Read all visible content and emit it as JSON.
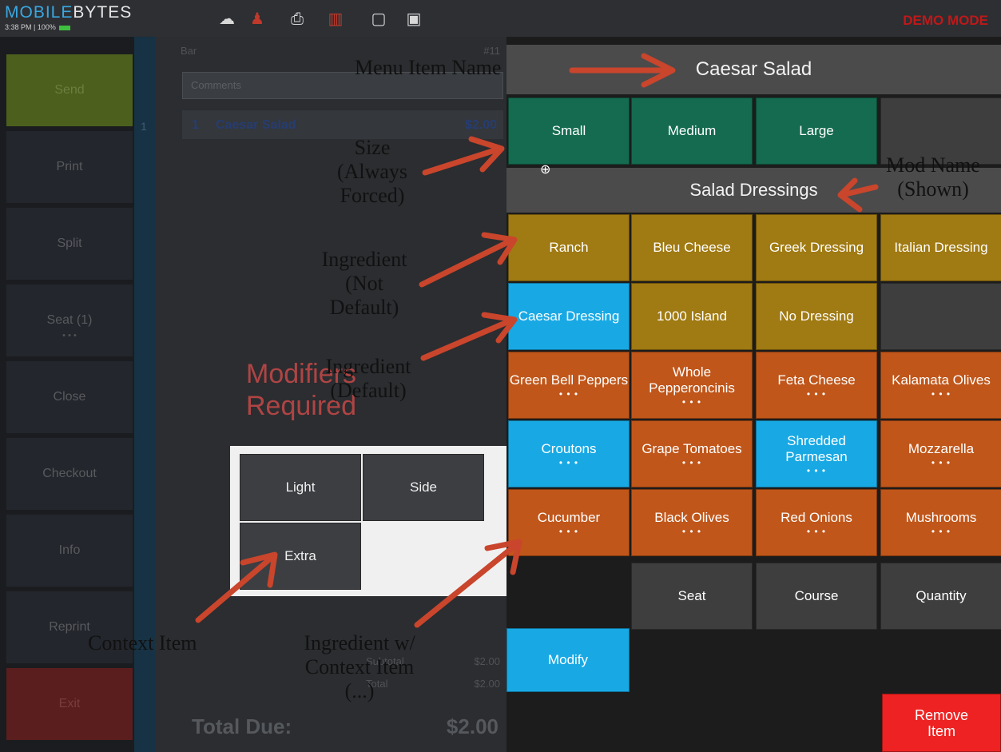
{
  "topbar": {
    "logo_a": "MOBILE",
    "logo_b": "BYTES",
    "time": "3:38 PM",
    "battery": "100%",
    "demo": "DEMO MODE",
    "icons": [
      "cloud-sync-icon",
      "user-icon",
      "printer-icon",
      "receipt-icon",
      "chat-icon",
      "table-icon"
    ]
  },
  "sidebar": {
    "send": "Send",
    "print": "Print",
    "split": "Split",
    "seat": "Seat (1)",
    "seat_dots": "• • •",
    "close": "Close",
    "checkout": "Checkout",
    "info": "Info",
    "reprint": "Reprint",
    "exit": "Exit"
  },
  "order": {
    "title": "Bar",
    "number": "#11",
    "comments_placeholder": "Comments",
    "seat_number": "1",
    "line": {
      "qty": "1",
      "name": "Caesar Salad",
      "price": "$2.00"
    },
    "subtotal_label": "Subtotal",
    "subtotal": "$2.00",
    "total_label": "Total",
    "total": "$2.00",
    "total_due_label": "Total Due:",
    "total_due": "$2.00"
  },
  "modifiers_required": [
    "Modifiers",
    "Required"
  ],
  "context_menu": {
    "light": "Light",
    "side": "Side",
    "extra": "Extra"
  },
  "item": {
    "name": "Caesar Salad",
    "sizes": [
      "Small",
      "Medium",
      "Large"
    ],
    "group": "Salad Dressings",
    "dressings": [
      {
        "label": "Ranch",
        "state": "not-default"
      },
      {
        "label": "Bleu Cheese",
        "state": "not-default"
      },
      {
        "label": "Greek Dressing",
        "state": "not-default"
      },
      {
        "label": "Italian Dressing",
        "state": "not-default"
      },
      {
        "label": "Caesar Dressing",
        "state": "default"
      },
      {
        "label": "1000 Island",
        "state": "not-default"
      },
      {
        "label": "No Dressing",
        "state": "not-default"
      }
    ],
    "toppings": [
      {
        "label": "Green Bell Peppers",
        "dots": "• • •"
      },
      {
        "label": "Whole Pepperoncinis",
        "dots": "• • •"
      },
      {
        "label": "Feta Cheese",
        "dots": "• • •"
      },
      {
        "label": "Kalamata Olives",
        "dots": "• • •"
      },
      {
        "label": "Croutons",
        "dots": "• • •"
      },
      {
        "label": "Grape Tomatoes",
        "dots": "• • •"
      },
      {
        "label": "Shredded Parmesan",
        "dots": "• • •"
      },
      {
        "label": "Mozzarella",
        "dots": "• • •"
      },
      {
        "label": "Cucumber",
        "dots": "• • •"
      },
      {
        "label": "Black Olives",
        "dots": "• • •"
      },
      {
        "label": "Red Onions",
        "dots": "• • •"
      },
      {
        "label": "Mushrooms",
        "dots": "• • •"
      }
    ]
  },
  "actions": {
    "seat": "Seat",
    "course": "Course",
    "quantity": "Quantity",
    "modify": "Modify",
    "remove": "Remove Item"
  },
  "annotations": {
    "menu_item_name": "Menu Item Name",
    "size": [
      "Size",
      "(Always",
      "Forced)"
    ],
    "mod_name": [
      "Mod Name",
      "(Shown)"
    ],
    "ingredient_not_default": [
      "Ingredient",
      "(Not",
      "Default)"
    ],
    "ingredient_default": [
      "Ingredient",
      "(Default)"
    ],
    "context_item": "Context Item",
    "ingredient_context": [
      "Ingredient w/",
      "Context Item",
      "(...)"
    ]
  },
  "colors": {
    "size": "#146b4f",
    "dressing": "#a07a12",
    "topping": "#c0561a",
    "default_selected": "#18a9e4",
    "remove": "#ee2222",
    "arrow": "#c9452c"
  }
}
